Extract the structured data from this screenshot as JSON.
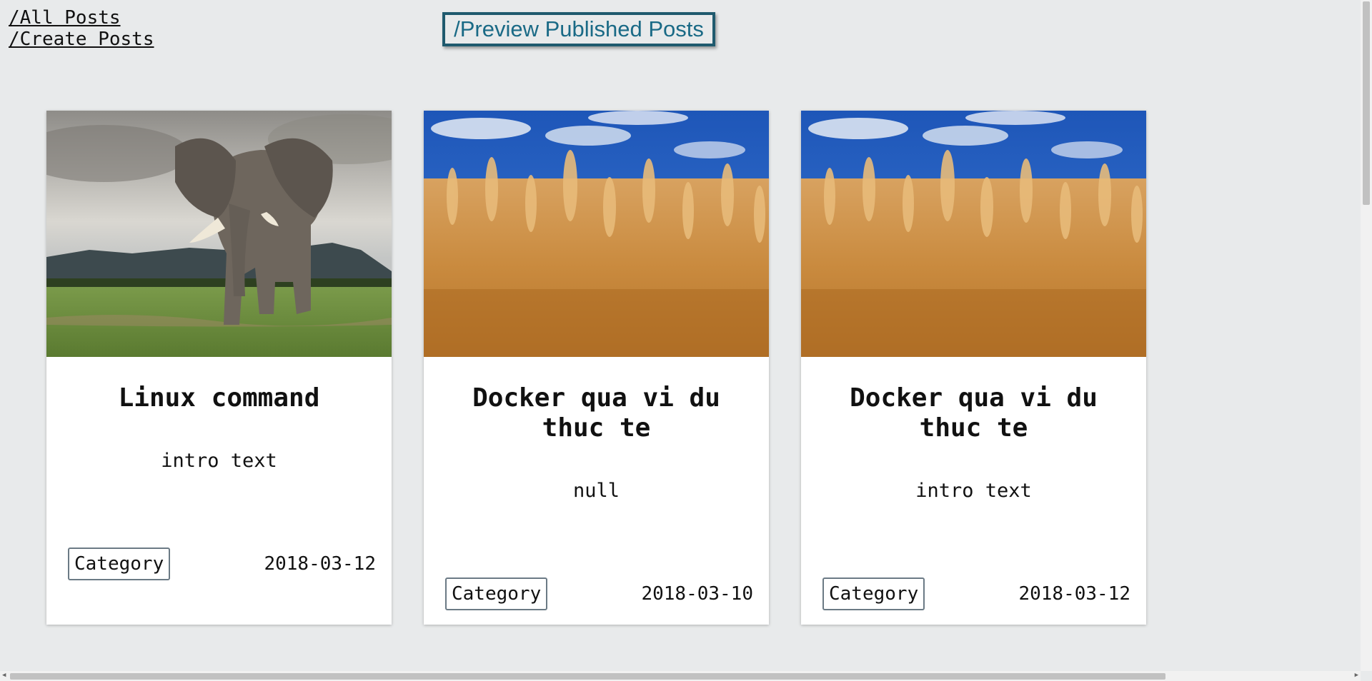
{
  "nav": {
    "all_posts": "/All Posts",
    "create_posts": "/Create Posts",
    "preview_published": "/Preview Published Posts"
  },
  "posts": [
    {
      "title": "Linux command",
      "intro": "intro text",
      "category": "Category",
      "date": "2018-03-12",
      "image": "elephant"
    },
    {
      "title": "Docker qua vi du thuc te",
      "intro": "null",
      "category": "Category",
      "date": "2018-03-10",
      "image": "wheat-field"
    },
    {
      "title": "Docker qua vi du thuc te",
      "intro": "intro text",
      "category": "Category",
      "date": "2018-03-12",
      "image": "wheat-field"
    }
  ],
  "colors": {
    "background": "#e8eaeb",
    "button_border": "#1f5a6e",
    "button_text": "#1a6a86"
  }
}
